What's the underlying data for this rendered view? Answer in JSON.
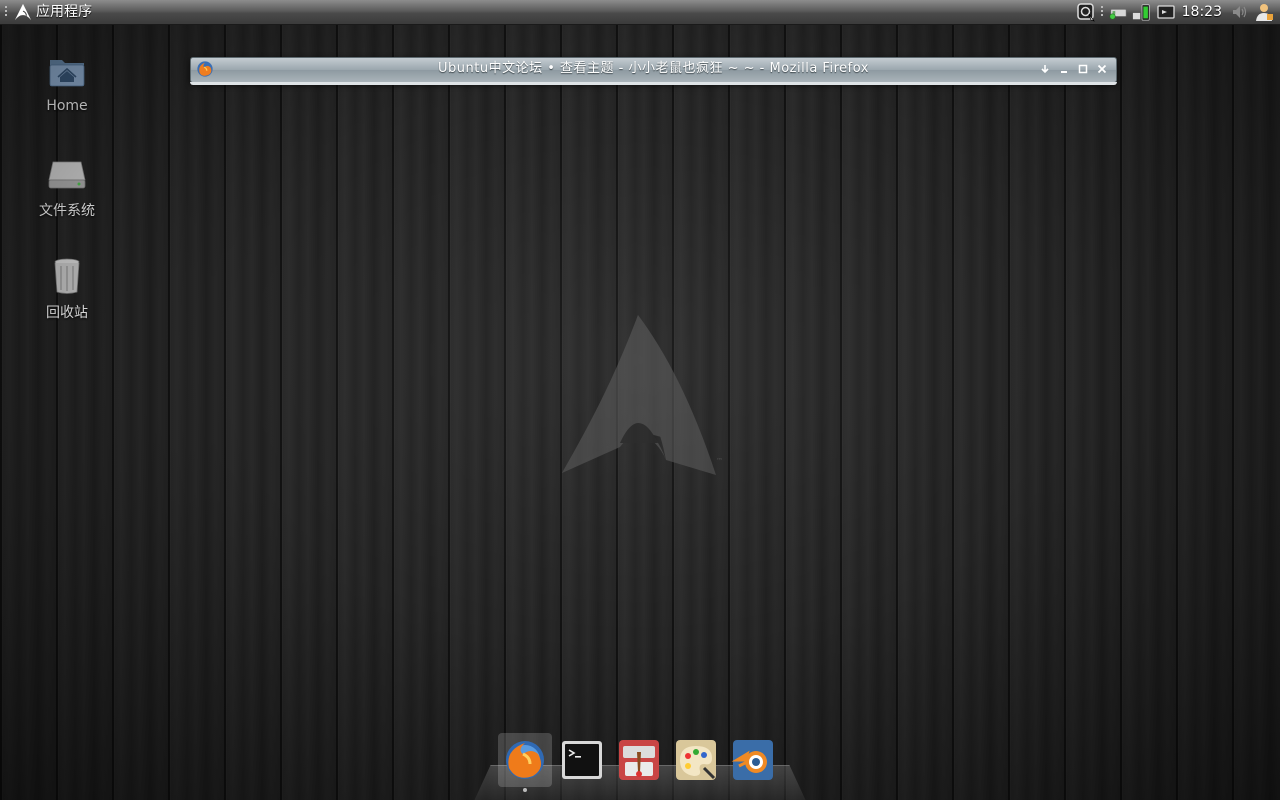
{
  "top_panel": {
    "menu_label": "应用程序",
    "clock": "18:23",
    "tray_icons": [
      "screenshot-app-icon",
      "network-icon",
      "battery-icon",
      "display-icon",
      "volume-icon",
      "user-icon"
    ]
  },
  "desktop": {
    "icons": [
      {
        "label": "Home",
        "icon": "home-folder-icon"
      },
      {
        "label": "文件系统",
        "icon": "hard-drive-icon"
      },
      {
        "label": "回收站",
        "icon": "trash-icon"
      }
    ]
  },
  "window": {
    "title": "Ubuntu中文论坛 • 查看主题 - 小小老鼠也疯狂 ~ ~ - Mozilla Firefox",
    "app_icon": "firefox-icon",
    "buttons": [
      "shade-button",
      "minimize-button",
      "maximize-button",
      "close-button"
    ]
  },
  "dock": {
    "items": [
      {
        "name": "firefox",
        "icon": "firefox-icon",
        "active": true
      },
      {
        "name": "terminal",
        "icon": "terminal-icon",
        "active": false
      },
      {
        "name": "toolbox",
        "icon": "toolbox-icon",
        "active": false
      },
      {
        "name": "paint",
        "icon": "paint-palette-icon",
        "active": false
      },
      {
        "name": "blender",
        "icon": "blender-icon",
        "active": false
      }
    ]
  },
  "colors": {
    "panel": "#4a4a4a",
    "titlebar": "#9aa6ad",
    "wallpaper": "#262626"
  }
}
